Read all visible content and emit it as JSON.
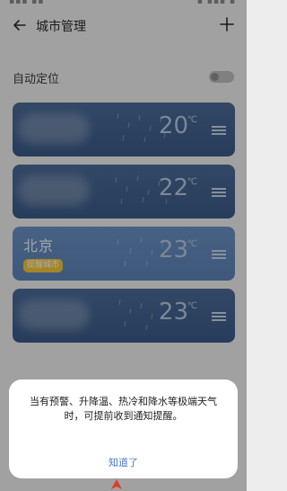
{
  "app": {
    "title": "城市管理"
  },
  "settings": {
    "auto_location_label": "自动定位",
    "auto_location_on": false
  },
  "cities": [
    {
      "name": "",
      "temperature": "20",
      "unit": "℃",
      "badge": ""
    },
    {
      "name": "",
      "temperature": "22",
      "unit": "℃",
      "badge": ""
    },
    {
      "name": "北京",
      "temperature": "23",
      "unit": "℃",
      "badge": "提醒城市"
    },
    {
      "name": "",
      "temperature": "23",
      "unit": "℃",
      "badge": ""
    }
  ],
  "dialog": {
    "message": "当有预警、升降温、热冷和降水等极端天气时，可提前收到通知提醒。",
    "confirm_label": "知道了"
  },
  "colors": {
    "card": "#3a5a86",
    "card_active": "#5c82b6",
    "badge": "#f2c63a",
    "dialog_button": "#4a78c8"
  },
  "icons": {
    "back": "arrow-left-icon",
    "add": "plus-icon",
    "drag": "drag-handle-icon"
  }
}
